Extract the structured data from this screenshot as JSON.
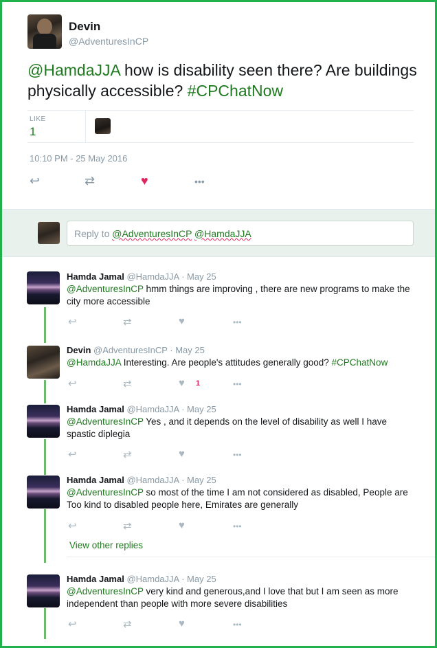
{
  "main_tweet": {
    "author_name": "Devin",
    "author_handle": "@AdventuresInCP",
    "text_mention": "@HamdaJJA",
    "text_body": " how is disability seen there? Are buildings physically accessible? ",
    "text_hashtag": "#CPChatNow",
    "like_label": "LIKE",
    "like_count": "1",
    "timestamp": "10:10 PM - 25 May 2016"
  },
  "reply_box": {
    "prefix": "Reply to ",
    "mention1": "@AdventuresInCP",
    "mention2": "@HamdaJJA"
  },
  "replies": [
    {
      "name": "Hamda Jamal",
      "meta": " @HamdaJJA · May 25",
      "mention": "@AdventuresInCP",
      "text": " hmm things are improving , there are new programs to make the city more accessible"
    },
    {
      "name": "Devin",
      "meta": " @AdventuresInCP · May 25",
      "mention": "@HamdaJJA",
      "text": " Interesting. Are people's attitudes generally good? ",
      "hashtag": "#CPChatNow",
      "like_count": "1"
    },
    {
      "name": "Hamda Jamal",
      "meta": " @HamdaJJA · May 25",
      "mention": "@AdventuresInCP",
      "text": " Yes , and it depends on the level of disability as well I have spastic  diplegia"
    },
    {
      "name": "Hamda Jamal",
      "meta": " @HamdaJJA · May 25",
      "mention": "@AdventuresInCP",
      "text": " so most of the time I am not considered as disabled, People are Too kind to disabled people here, Emirates are generally"
    },
    {
      "name": "Hamda Jamal",
      "meta": " @HamdaJJA · May 25",
      "mention": "@AdventuresInCP",
      "text": " very kind and generous,and I love that but I am seen as more independent than people with more severe disabilities"
    }
  ],
  "view_more": "View other replies",
  "icons": {
    "reply": "↩",
    "retweet": "⇄",
    "like": "♥",
    "more": "•••"
  },
  "colors": {
    "accent": "#1f7a1f",
    "heart": "#e0245e",
    "border": "#21b24b"
  }
}
